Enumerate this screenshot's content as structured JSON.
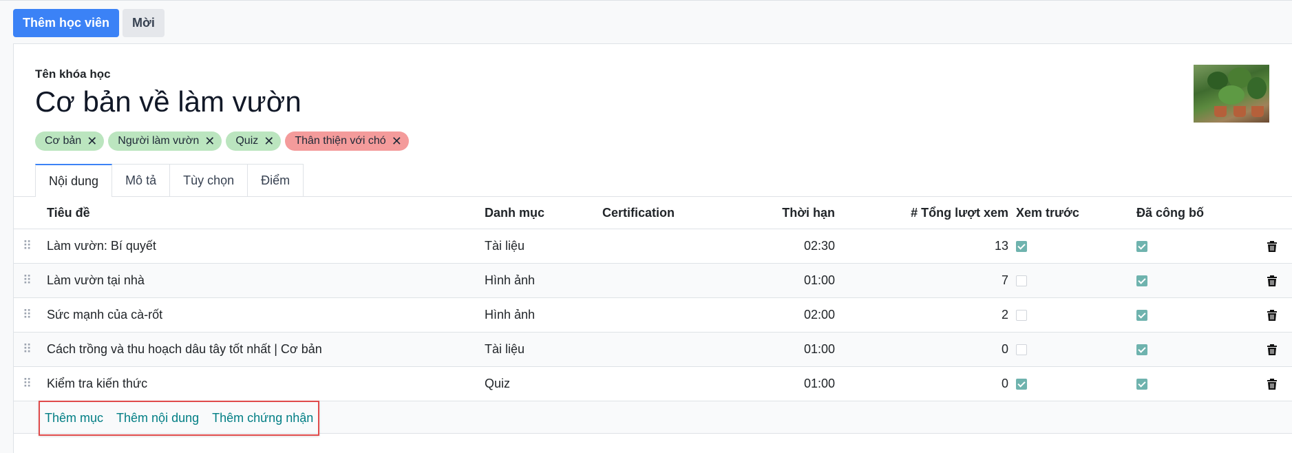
{
  "toolbar": {
    "add_students": "Thêm học viên",
    "invite": "Mời"
  },
  "course": {
    "label": "Tên khóa học",
    "title": "Cơ bản về làm vườn"
  },
  "tags": [
    {
      "label": "Cơ bản",
      "color": "#bbe5bf"
    },
    {
      "label": "Người làm vườn",
      "color": "#bbe5bf"
    },
    {
      "label": "Quiz",
      "color": "#bbe5bf"
    },
    {
      "label": "Thân thiện với chó",
      "color": "#f49b9b"
    }
  ],
  "tabs": [
    "Nội dung",
    "Mô tả",
    "Tùy chọn",
    "Điểm"
  ],
  "table": {
    "headers": {
      "title": "Tiêu đề",
      "category": "Danh mục",
      "certification": "Certification",
      "duration": "Thời hạn",
      "views": "# Tổng lượt xem",
      "preview": "Xem trước",
      "published": "Đã công bố"
    },
    "rows": [
      {
        "title": "Làm vườn: Bí quyết",
        "category": "Tài liệu",
        "duration": "02:30",
        "views": "13",
        "preview": true,
        "published": true
      },
      {
        "title": "Làm vườn tại nhà",
        "category": "Hình ảnh",
        "duration": "01:00",
        "views": "7",
        "preview": false,
        "published": true
      },
      {
        "title": "Sức mạnh của cà-rốt",
        "category": "Hình ảnh",
        "duration": "02:00",
        "views": "2",
        "preview": false,
        "published": true
      },
      {
        "title": "Cách trồng và thu hoạch dâu tây tốt nhất | Cơ bản",
        "category": "Tài liệu",
        "duration": "01:00",
        "views": "0",
        "preview": false,
        "published": true
      },
      {
        "title": "Kiểm tra kiến thức",
        "category": "Quiz",
        "duration": "01:00",
        "views": "0",
        "preview": true,
        "published": true
      }
    ]
  },
  "actions": {
    "add_section": "Thêm mục",
    "add_content": "Thêm nội dung",
    "add_certification": "Thêm chứng nhận"
  },
  "colors": {
    "primary": "#3b82f6",
    "link": "#017e84",
    "check": "#6fb3ae",
    "highlight": "#e04b4b"
  }
}
